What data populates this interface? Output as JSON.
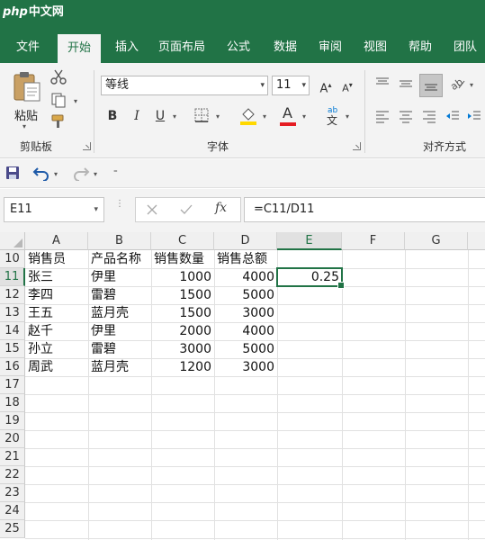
{
  "watermark": {
    "brand": "php",
    "site": "中文网"
  },
  "tabs": [
    "文件",
    "开始",
    "插入",
    "页面布局",
    "公式",
    "数据",
    "审阅",
    "视图",
    "帮助",
    "团队"
  ],
  "active_tab": "开始",
  "ribbon": {
    "clipboard": {
      "label": "剪贴板",
      "paste_label": "粘贴"
    },
    "font": {
      "label": "字体",
      "font_name": "等线",
      "font_size": "11",
      "bold": "B",
      "italic": "I",
      "underline": "U",
      "font_color_glyph": "A"
    },
    "alignment": {
      "label": "对齐方式"
    }
  },
  "formula_bar": {
    "name_box": "E11",
    "fx": "fx",
    "formula": "=C11/D11"
  },
  "colors": {
    "accent": "#217346",
    "font_color": "#e51c23",
    "fill_color": "#ffd800"
  },
  "sheet": {
    "columns": [
      "A",
      "B",
      "C",
      "D",
      "E",
      "F",
      "G"
    ],
    "selected_column": "E",
    "rows": [
      "10",
      "11",
      "12",
      "13",
      "14",
      "15",
      "16",
      "17",
      "18",
      "19",
      "20",
      "21",
      "22",
      "23",
      "24",
      "25"
    ],
    "selected_row": "11",
    "header": {
      "a": "销售员",
      "b": "产品名称",
      "c": "销售数量",
      "d": "销售总额"
    },
    "data": [
      {
        "a": "张三",
        "b": "伊里",
        "c": "1000",
        "d": "4000",
        "e": "0.25"
      },
      {
        "a": "李四",
        "b": "雷碧",
        "c": "1500",
        "d": "5000",
        "e": ""
      },
      {
        "a": "王五",
        "b": "蓝月壳",
        "c": "1500",
        "d": "3000",
        "e": ""
      },
      {
        "a": "赵千",
        "b": "伊里",
        "c": "2000",
        "d": "4000",
        "e": ""
      },
      {
        "a": "孙立",
        "b": "雷碧",
        "c": "3000",
        "d": "5000",
        "e": ""
      },
      {
        "a": "周武",
        "b": "蓝月壳",
        "c": "1200",
        "d": "3000",
        "e": ""
      }
    ]
  }
}
